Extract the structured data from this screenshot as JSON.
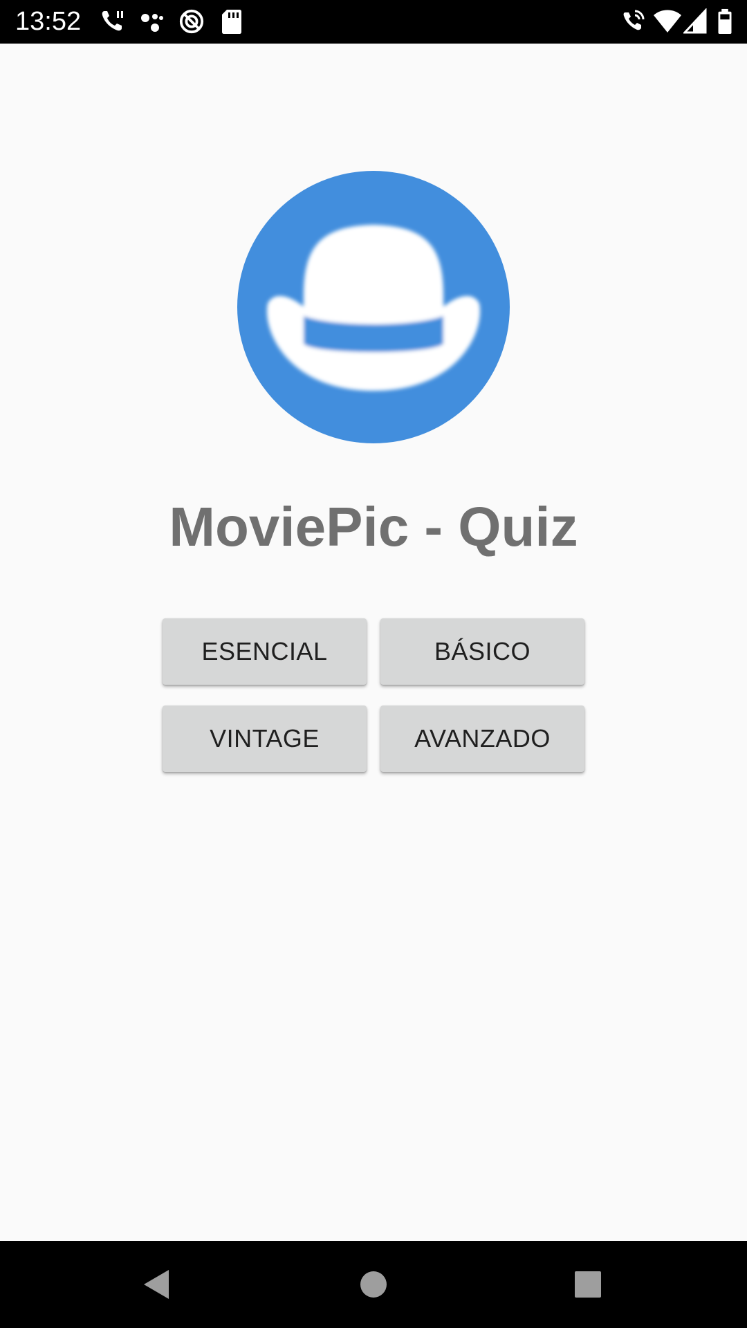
{
  "status_bar": {
    "time": "13:52",
    "left_icons": [
      "phone-call-icon",
      "assistant-dots-icon",
      "do-not-disturb-icon",
      "sd-card-icon"
    ],
    "right_icons": [
      "wifi-calling-icon",
      "wifi-icon",
      "cellular-signal-icon",
      "battery-icon"
    ]
  },
  "app": {
    "logo_icon": "bowler-hat-icon",
    "logo_color": "#428edd",
    "title": "MoviePic - Quiz"
  },
  "levels": {
    "esencial": "ESENCIAL",
    "basico": "BÁSICO",
    "vintage": "VINTAGE",
    "avanzado": "AVANZADO"
  },
  "nav_bar": {
    "buttons": [
      "back-icon",
      "home-icon",
      "recents-icon"
    ]
  },
  "colors": {
    "background": "#fafafa",
    "title": "#707070",
    "button_bg": "#d6d7d7",
    "button_text": "#1f1f1f"
  }
}
